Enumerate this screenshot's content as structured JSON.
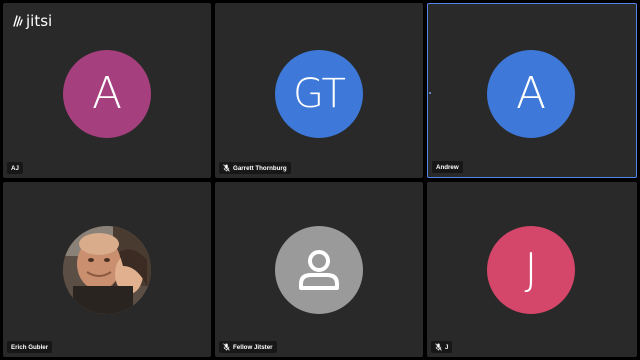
{
  "app": {
    "logo_text": "jitsi"
  },
  "colors": {
    "tile_bg": "#292929",
    "active_border": "#4f86e8",
    "avatar_magenta": "#a63f7d",
    "avatar_blue": "#3e78d8",
    "avatar_red": "#d4476a",
    "avatar_gray": "#9a9a9a"
  },
  "participants": [
    {
      "name": "AJ",
      "initials": "A",
      "muted": false,
      "avatar_color": "#a63f7d",
      "active": false
    },
    {
      "name": "Garrett Thornburg",
      "initials": "GT",
      "muted": true,
      "avatar_color": "#3e78d8",
      "active": false
    },
    {
      "name": "Andrew",
      "initials": "A",
      "muted": false,
      "avatar_color": "#3e78d8",
      "active": true
    },
    {
      "name": "Erich Gubler",
      "initials": "",
      "muted": false,
      "avatar_type": "photo",
      "active": false
    },
    {
      "name": "Fellow Jitster",
      "initials": "",
      "muted": true,
      "avatar_color": "#9a9a9a",
      "avatar_type": "generic-user-icon",
      "active": false
    },
    {
      "name": "J",
      "initials": "J",
      "muted": true,
      "avatar_color": "#d4476a",
      "active": false
    }
  ]
}
